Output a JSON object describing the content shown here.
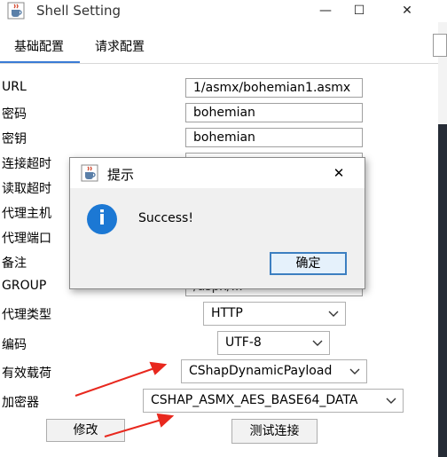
{
  "window": {
    "title": "Shell Setting",
    "minimize_glyph": "—",
    "maximize_glyph": "☐",
    "close_glyph": "✕"
  },
  "tabs": [
    {
      "label": "基础配置",
      "active": true
    },
    {
      "label": "请求配置",
      "active": false
    }
  ],
  "form": {
    "url_label": "URL",
    "url_value": "1/asmx/bohemian1.asmx",
    "password_label": "密码",
    "password_value": "bohemian",
    "secret_label": "密钥",
    "secret_value": "bohemian",
    "connect_timeout_label": "连接超时",
    "read_timeout_label": "读取超时",
    "proxy_host_label": "代理主机",
    "proxy_port_label": "代理端口",
    "note_label": "备注",
    "group_label": "GROUP",
    "group_value": "/aspx/...",
    "proxy_type_label": "代理类型",
    "proxy_type_value": "HTTP",
    "encoding_label": "编码",
    "encoding_value": "UTF-8",
    "payload_label": "有效载荷",
    "payload_value": "CShapDynamicPayload",
    "encryptor_label": "加密器",
    "encryptor_value": "CSHAP_ASMX_AES_BASE64_DATA",
    "modify_button": "修改",
    "test_button": "测试连接"
  },
  "dialog": {
    "title": "提示",
    "message": "Success!",
    "ok_button": "确定",
    "close_glyph": "✕"
  },
  "colors": {
    "accent": "#3a7bd5",
    "info_icon": "#1c78d4",
    "arrow": "#e8281e"
  }
}
